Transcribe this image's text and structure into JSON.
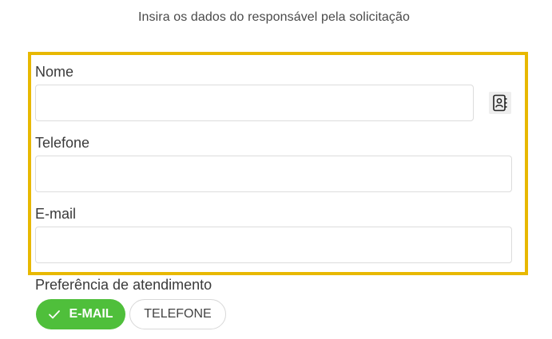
{
  "header": {
    "subtitle": "Insira os dados do responsável pela solicitação"
  },
  "form": {
    "name_label": "Nome",
    "name_value": "",
    "phone_label": "Telefone",
    "phone_value": "",
    "email_label": "E-mail",
    "email_value": "",
    "contact_icon": "contact-book-icon"
  },
  "preference": {
    "label": "Preferência de atendimento",
    "options": [
      {
        "label": "E-MAIL",
        "selected": true
      },
      {
        "label": "TELEFONE",
        "selected": false
      }
    ]
  },
  "colors": {
    "highlight_border": "#e8b800",
    "selected_chip": "#4fbf3b"
  }
}
